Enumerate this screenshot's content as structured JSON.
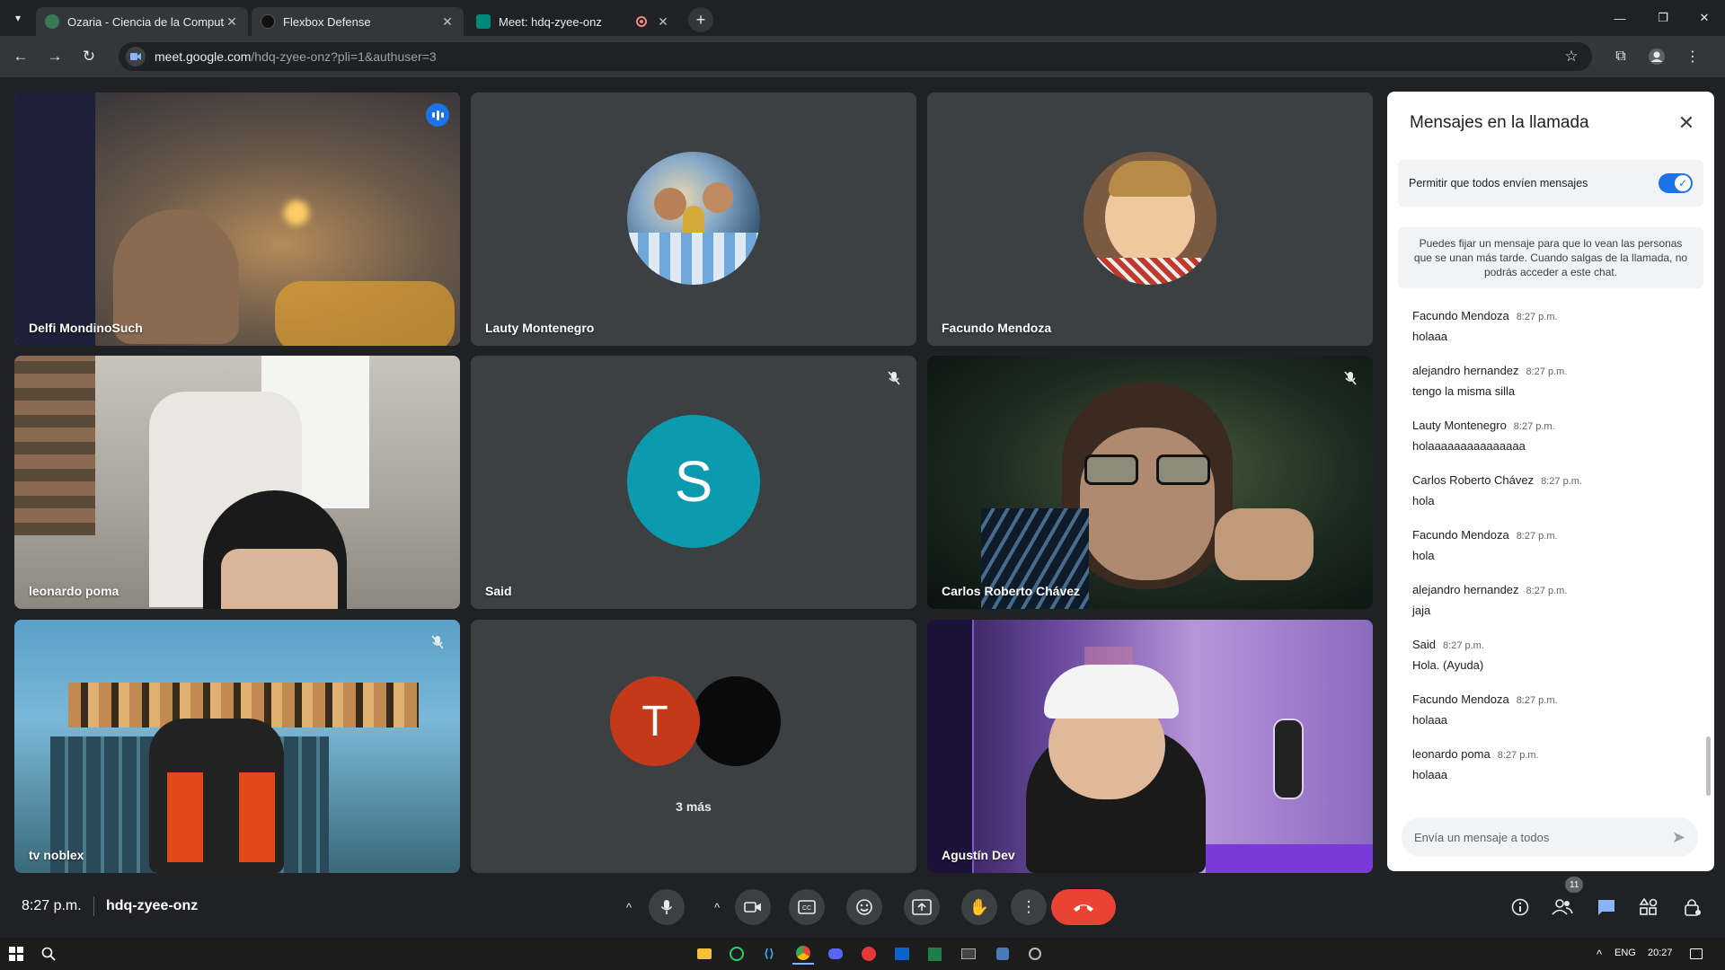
{
  "browser": {
    "tabs": [
      {
        "title": "Ozaria - Ciencia de la Computa",
        "active": false,
        "favicon_color": "#3b7a57"
      },
      {
        "title": "Flexbox Defense",
        "active": false,
        "favicon_color": "#111111"
      },
      {
        "title": "Meet: hdq-zyee-onz",
        "active": true,
        "favicon_color": "#00897b",
        "recording": true
      }
    ],
    "url_host": "meet.google.com",
    "url_path": "/hdq-zyee-onz?pli=1&authuser=3"
  },
  "participants": [
    {
      "name": "Delfi MondinoSuch",
      "kind": "video",
      "speaking": true,
      "muted": false
    },
    {
      "name": "Lauty Montenegro",
      "kind": "photo",
      "muted": false
    },
    {
      "name": "Facundo Mendoza",
      "kind": "photo",
      "muted": false
    },
    {
      "name": "leonardo poma",
      "kind": "video",
      "muted": false
    },
    {
      "name": "Said",
      "kind": "letter",
      "letter": "S",
      "avatar_color": "#0b9aae",
      "muted": true
    },
    {
      "name": "Carlos Roberto Chávez",
      "kind": "video",
      "muted": true
    },
    {
      "name": "tv noblex",
      "kind": "video",
      "muted": true
    },
    {
      "name": "",
      "kind": "more",
      "letter": "T",
      "avatar_color": "#c5391b",
      "more_label": "3 más"
    },
    {
      "name": "Agustín Dev",
      "kind": "video",
      "muted": false
    }
  ],
  "chat": {
    "title": "Mensajes en la llamada",
    "permission_label": "Permitir que todos envíen mensajes",
    "permission_on": true,
    "info": "Puedes fijar un mensaje para que lo vean las personas que se unan más tarde. Cuando salgas de la llamada, no podrás acceder a este chat.",
    "compose_placeholder": "Envía un mensaje a todos",
    "messages": [
      {
        "sender": "Facundo Mendoza",
        "time": "8:27 p.m.",
        "text": "holaaa"
      },
      {
        "sender": "alejandro hernandez",
        "time": "8:27 p.m.",
        "text": "tengo la misma silla"
      },
      {
        "sender": "Lauty Montenegro",
        "time": "8:27 p.m.",
        "text": "holaaaaaaaaaaaaaaa"
      },
      {
        "sender": "Carlos Roberto Chávez",
        "time": "8:27 p.m.",
        "text": "hola"
      },
      {
        "sender": "Facundo Mendoza",
        "time": "8:27 p.m.",
        "text": "hola"
      },
      {
        "sender": "alejandro hernandez",
        "time": "8:27 p.m.",
        "text": "jaja"
      },
      {
        "sender": "Said",
        "time": "8:27 p.m.",
        "text": "Hola. (Ayuda)"
      },
      {
        "sender": "Facundo Mendoza",
        "time": "8:27 p.m.",
        "text": "holaaa"
      },
      {
        "sender": "leonardo poma",
        "time": "8:27 p.m.",
        "text": "holaaa"
      }
    ]
  },
  "meeting": {
    "time": "8:27 p.m.",
    "code": "hdq-zyee-onz",
    "participants_badge": "11"
  },
  "taskbar": {
    "language": "ENG",
    "clock": "20:27"
  },
  "colors": {
    "accent": "#1a73e8",
    "end_call": "#ea4335",
    "speaking_outline": "#8ab4f8"
  }
}
